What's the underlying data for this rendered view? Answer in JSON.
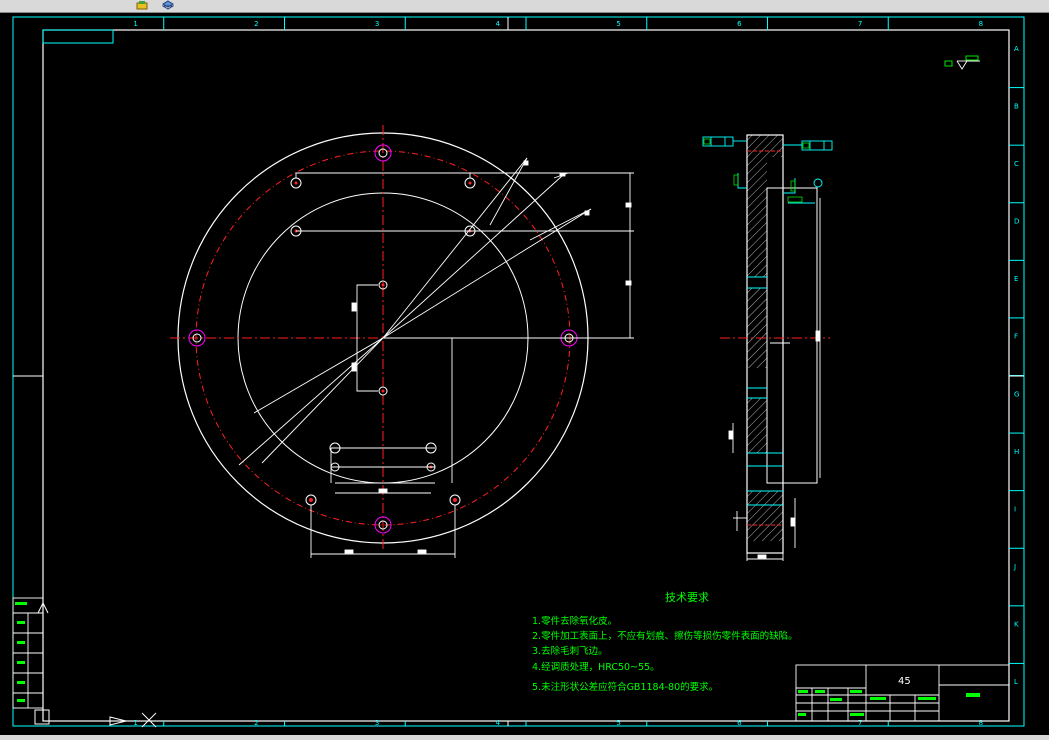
{
  "toolbar": {
    "icons": [
      "layer-icon",
      "layers-stack-icon"
    ]
  },
  "frame": {
    "columns": [
      "1",
      "2",
      "3",
      "4",
      "5",
      "6",
      "7",
      "8"
    ],
    "rows": [
      "A",
      "B",
      "C",
      "D",
      "E",
      "F",
      "G",
      "H",
      "I",
      "J",
      "K",
      "L"
    ]
  },
  "tech": {
    "title": "技术要求",
    "lines": [
      "1.零件去除氧化皮。",
      "2.零件加工表面上，不应有划痕、擦伤等损伤零件表面的缺陷。",
      "3.去除毛刺飞边。",
      "4.经调质处理，HRC50~55。",
      "5.未注形状公差应符合GB1184-80的要求。"
    ]
  },
  "titleblock": {
    "material": "45"
  },
  "colors": {
    "white": "#ffffff",
    "cyan": "#00ffff",
    "green": "#00ff00",
    "red": "#ff2020",
    "magenta": "#ff00ff"
  }
}
